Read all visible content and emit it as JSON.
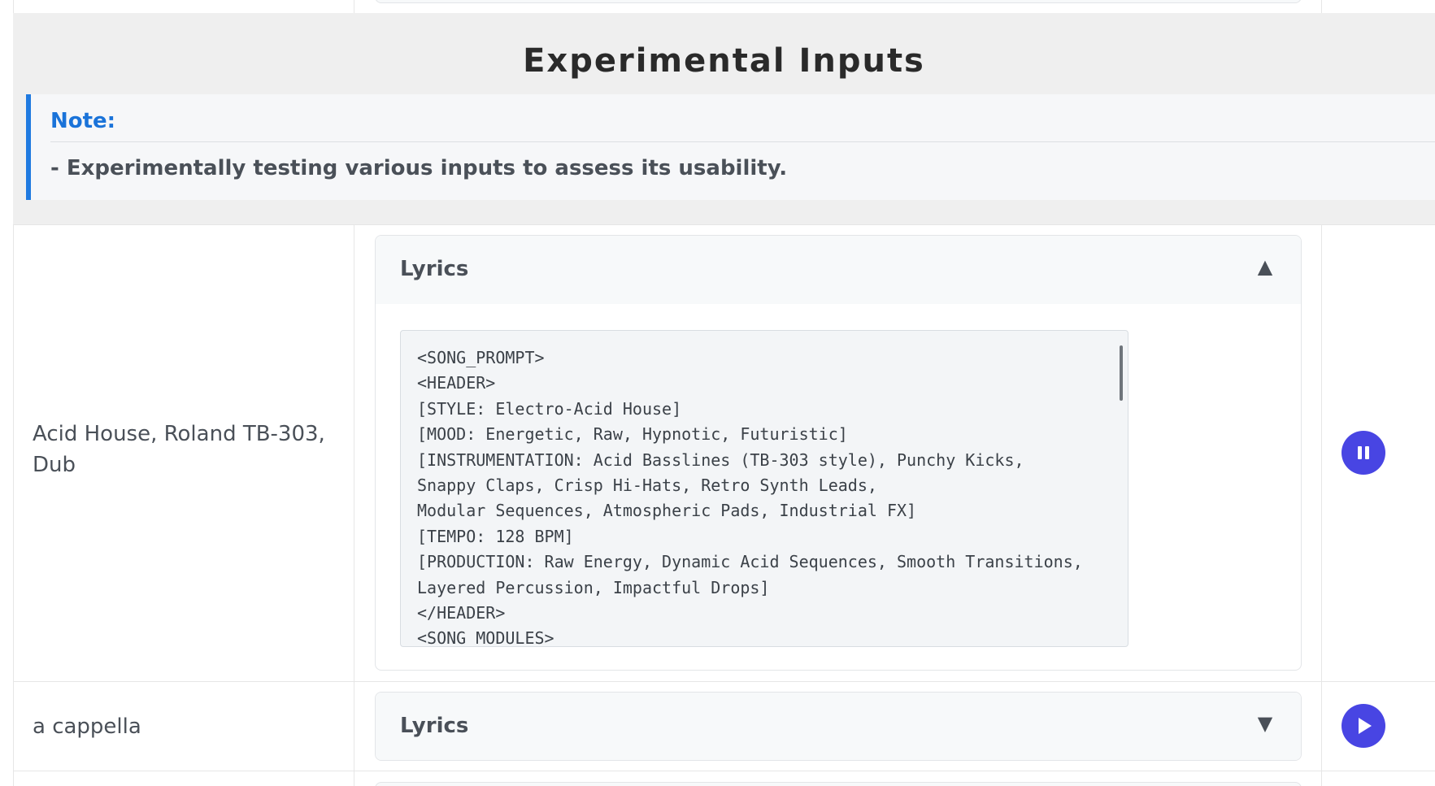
{
  "section": {
    "title": "Experimental Inputs",
    "note_title": "Note:",
    "note_text": "- Experimentally testing various inputs to assess its usability."
  },
  "rows": [
    {
      "label": "Acid House, Roland TB-303, Dub",
      "lyrics_title": "Lyrics",
      "expanded": true,
      "toggle_icon": "▲",
      "play_state": "pause",
      "lyrics_lines": [
        "<SONG_PROMPT>",
        "<HEADER>",
        "[STYLE: Electro-Acid House]",
        "[MOOD: Energetic, Raw, Hypnotic, Futuristic]",
        "[INSTRUMENTATION: Acid Basslines (TB-303 style), Punchy Kicks,",
        "Snappy Claps, Crisp Hi-Hats, Retro Synth Leads,",
        "Modular Sequences, Atmospheric Pads, Industrial FX]",
        "[TEMPO: 128 BPM]",
        "[PRODUCTION: Raw Energy, Dynamic Acid Sequences, Smooth Transitions,",
        "Layered Percussion, Impactful Drops]",
        "</HEADER>",
        "<SONG_MODULES>"
      ]
    },
    {
      "label": "a cappella",
      "lyrics_title": "Lyrics",
      "expanded": false,
      "toggle_icon": "▼",
      "play_state": "play"
    }
  ],
  "colors": {
    "accent_blue": "#1f7ae0",
    "play_button": "#4845e3",
    "section_bg": "#efefef"
  }
}
